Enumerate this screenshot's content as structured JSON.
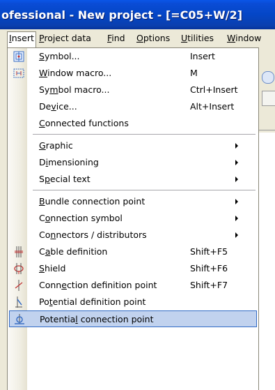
{
  "window": {
    "title": "ofessional - New project - [=C05+W/2]"
  },
  "menubar": {
    "items": [
      {
        "label": "Insert",
        "mnemonic": "I",
        "rest": "nsert"
      },
      {
        "label": "Project data",
        "mnemonic": "P",
        "rest": "roject data"
      },
      {
        "label": "Find",
        "mnemonic": "F",
        "rest": "ind"
      },
      {
        "label": "Options",
        "mnemonic": "O",
        "rest": "ptions"
      },
      {
        "label": "Utilities",
        "mnemonic": "U",
        "rest": "tilities"
      },
      {
        "label": "Window",
        "mnemonic": "W",
        "rest": "indow"
      }
    ]
  },
  "insert_menu": {
    "items": [
      {
        "pre": "",
        "u": "S",
        "post": "ymbol...",
        "shortcut": "Insert",
        "icon": "symbol-icon"
      },
      {
        "pre": "",
        "u": "W",
        "post": "indow macro...",
        "shortcut": "M",
        "icon": "window-macro-icon"
      },
      {
        "pre": "Sy",
        "u": "m",
        "post": "bol macro...",
        "shortcut": "Ctrl+Insert"
      },
      {
        "pre": "De",
        "u": "v",
        "post": "ice...",
        "shortcut": "Alt+Insert"
      },
      {
        "pre": "",
        "u": "C",
        "post": "onnected functions"
      },
      {
        "pre": "",
        "u": "G",
        "post": "raphic",
        "submenu": true
      },
      {
        "pre": "D",
        "u": "i",
        "post": "mensioning",
        "submenu": true
      },
      {
        "pre": "S",
        "u": "p",
        "post": "ecial text",
        "submenu": true
      },
      {
        "pre": "",
        "u": "B",
        "post": "undle connection point",
        "submenu": true
      },
      {
        "pre": "C",
        "u": "o",
        "post": "nnection symbol",
        "submenu": true
      },
      {
        "pre": "Co",
        "u": "n",
        "post": "nectors / distributors",
        "submenu": true
      },
      {
        "pre": "C",
        "u": "a",
        "post": "ble definition",
        "shortcut": "Shift+F5",
        "icon": "cable-definition-icon"
      },
      {
        "pre": "",
        "u": "S",
        "post": "hield",
        "shortcut": "Shift+F6",
        "icon": "shield-icon"
      },
      {
        "pre": "Conn",
        "u": "e",
        "post": "ction definition point",
        "shortcut": "Shift+F7",
        "icon": "connection-definition-point-icon"
      },
      {
        "pre": "Po",
        "u": "t",
        "post": "ential definition point",
        "icon": "potential-definition-point-icon"
      },
      {
        "pre": "Potentia",
        "u": "l",
        "post": " connection point",
        "icon": "potential-connection-point-icon",
        "selected": true
      }
    ]
  },
  "colors": {
    "title_bar": "#0446c6",
    "selection_fill": "#c1d2ee",
    "selection_border": "#316ac5"
  }
}
